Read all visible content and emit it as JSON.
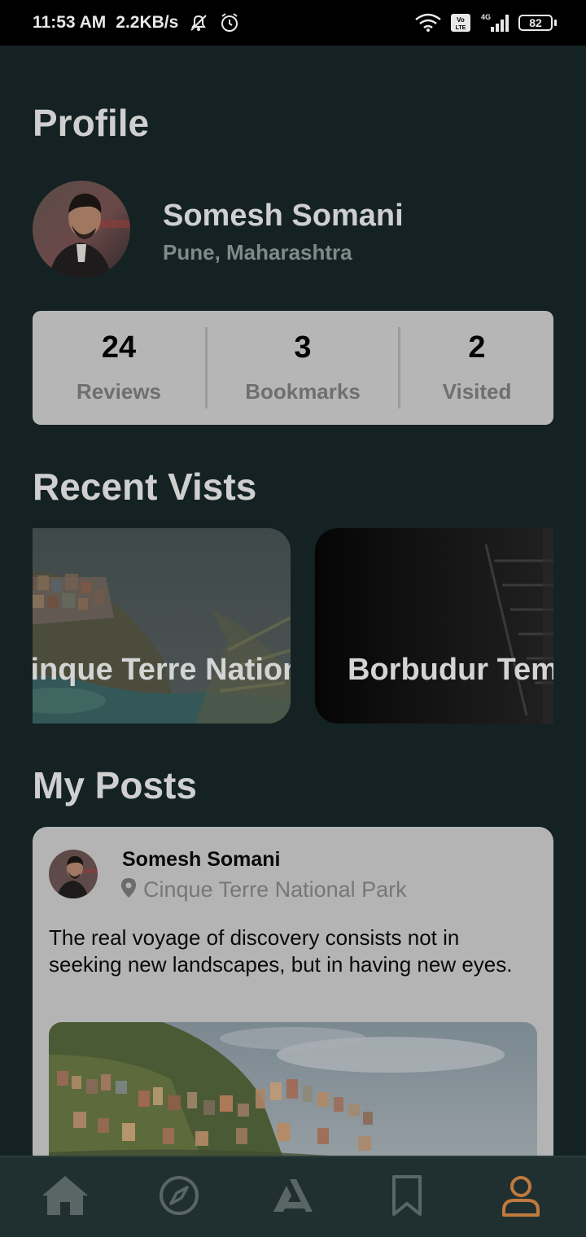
{
  "status_bar": {
    "time": "11:53 AM",
    "network_speed": "2.2KB/s",
    "battery": "82",
    "network_type": "4G",
    "volte": "Vo LTE",
    "icons": [
      "mute-icon",
      "alarm-icon",
      "wifi-icon",
      "volte-icon",
      "signal-icon",
      "battery-icon"
    ]
  },
  "page": {
    "title": "Profile"
  },
  "profile": {
    "name": "Somesh Somani",
    "location": "Pune, Maharashtra"
  },
  "stats": [
    {
      "value": "24",
      "label": "Reviews"
    },
    {
      "value": "3",
      "label": "Bookmarks"
    },
    {
      "value": "2",
      "label": "Visited"
    }
  ],
  "recent_visits": {
    "title": "Recent Vists",
    "items": [
      {
        "label": "Cinque Terre National Park"
      },
      {
        "label": "Borbudur Temple"
      }
    ]
  },
  "posts": {
    "title": "My Posts",
    "items": [
      {
        "author": "Somesh Somani",
        "location": "Cinque Terre National Park",
        "text": "The real voyage of discovery consists not in seeking new landscapes, but in having new eyes."
      }
    ]
  },
  "bottom_nav": {
    "items": [
      {
        "icon": "home-icon"
      },
      {
        "icon": "compass-icon"
      },
      {
        "icon": "app-logo-icon"
      },
      {
        "icon": "bookmark-icon"
      },
      {
        "icon": "profile-icon",
        "active": true
      }
    ],
    "active_color": "#c07a3e",
    "inactive_color": "#5a6666"
  }
}
